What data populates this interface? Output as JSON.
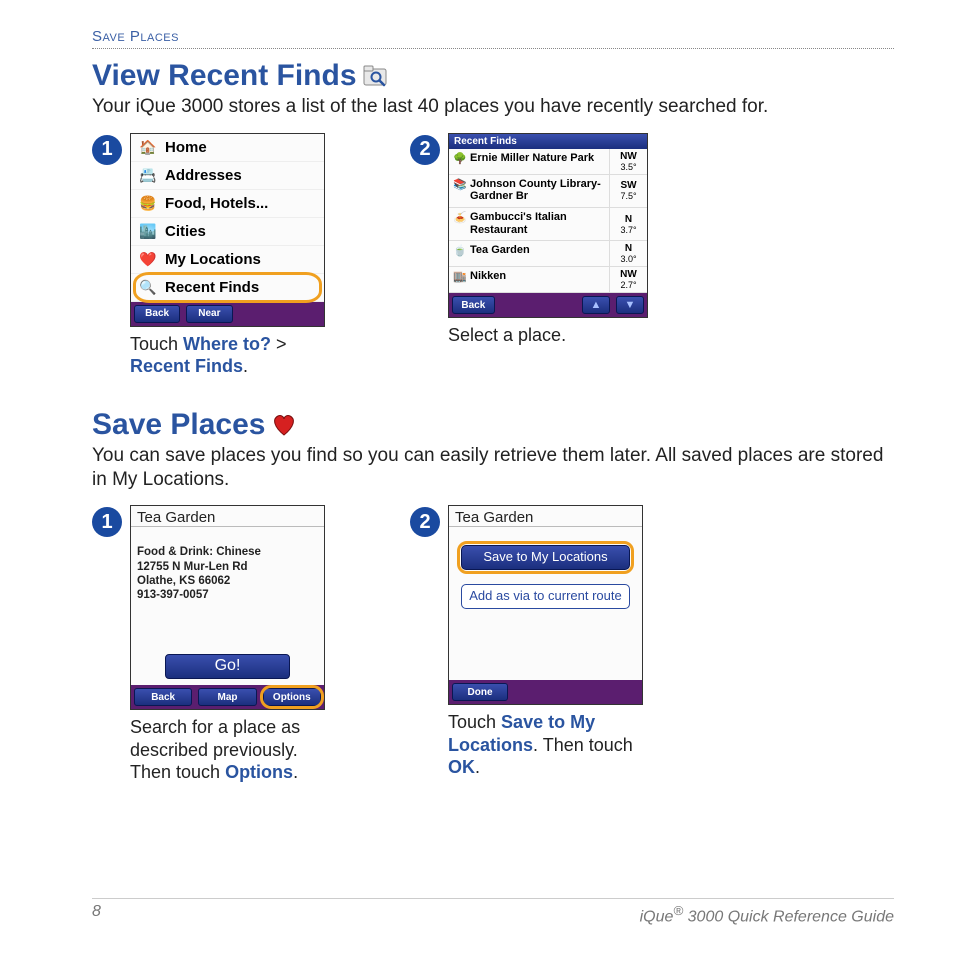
{
  "header_label": "Save Places",
  "section1": {
    "title": "View Recent Finds",
    "intro": "Your iQue 3000 stores a list of the last 40 places you have recently searched for.",
    "step1": {
      "num": "1",
      "menu": [
        "Home",
        "Addresses",
        "Food, Hotels...",
        "Cities",
        "My Locations",
        "Recent Finds"
      ],
      "footer_back": "Back",
      "footer_near": "Near",
      "caption_pre": "Touch ",
      "caption_kw1": "Where to?",
      "caption_mid": " > ",
      "caption_kw2": "Recent Finds",
      "caption_post": "."
    },
    "step2": {
      "num": "2",
      "titlebar": "Recent Finds",
      "rows": [
        {
          "name": "Ernie Miller Nature Park",
          "dir": "NW",
          "dist": "3.5°"
        },
        {
          "name": "Johnson County Library-Gardner Br",
          "dir": "SW",
          "dist": "7.5°"
        },
        {
          "name": "Gambucci's Italian Restaurant",
          "dir": "N",
          "dist": "3.7°"
        },
        {
          "name": "Tea Garden",
          "dir": "N",
          "dist": "3.0°"
        },
        {
          "name": "Nikken",
          "dir": "NW",
          "dist": "2.7°"
        }
      ],
      "footer_back": "Back",
      "caption": "Select a place."
    }
  },
  "section2": {
    "title": "Save Places",
    "intro": "You can save places you find so you can easily retrieve them later. All saved places are stored in My Locations.",
    "step1": {
      "num": "1",
      "place_title": "Tea Garden",
      "detail_line1": "Food & Drink: Chinese",
      "detail_line2": "12755 N Mur-Len Rd",
      "detail_line3": "Olathe, KS 66062",
      "detail_line4": "913-397-0057",
      "go": "Go!",
      "footer_back": "Back",
      "footer_map": "Map",
      "footer_options": "Options",
      "caption_pre": "Search for a place as described previously. Then touch ",
      "caption_kw": "Options",
      "caption_post": "."
    },
    "step2": {
      "num": "2",
      "place_title": "Tea Garden",
      "btn_save": "Save to My Locations",
      "btn_via": "Add as via to current route",
      "footer_done": "Done",
      "caption_pre": "Touch ",
      "caption_kw1": "Save to My Locations",
      "caption_mid": ". Then touch ",
      "caption_kw2": "OK",
      "caption_post": "."
    }
  },
  "footer": {
    "page_num": "8",
    "guide_pre": "iQue",
    "guide_post": " 3000 Quick Reference Guide"
  }
}
